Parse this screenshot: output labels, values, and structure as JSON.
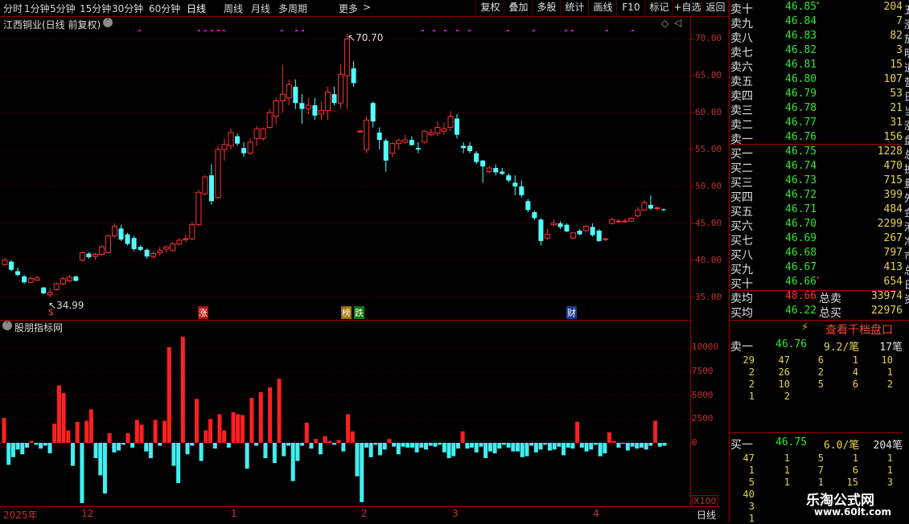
{
  "toolbar": {
    "periods": [
      "分时",
      "1分钟",
      "5分钟",
      "15分钟",
      "30分钟",
      "60分钟",
      "日线",
      "周线",
      "月线",
      "多周期",
      "更多"
    ],
    "active_period": "日线",
    "more_arrow": ">",
    "right_buttons": [
      "复权",
      "叠加",
      "多股",
      "统计",
      "画线",
      "F10",
      "标记",
      "+自选",
      "返回"
    ]
  },
  "chart": {
    "title": "江西铜业(日线 前复权)",
    "high_label": "70.70",
    "low_label": "34.99",
    "event_marks": [
      "$",
      "涨",
      "榜",
      "跌",
      "财"
    ],
    "colors": {
      "up": "#ff3232",
      "down": "#54ffff",
      "grid": "#800000",
      "axis_text": "#c03030",
      "magenta": "#ff00ff"
    }
  },
  "chart_data": [
    {
      "type": "candlestick",
      "title": "江西铜业(日线 前复权)",
      "ylim": [
        33,
        72
      ],
      "y_ticks": [
        35.0,
        40.0,
        45.0,
        50.0,
        55.0,
        60.0,
        65.0,
        70.0
      ],
      "ohlc": [
        [
          39.4,
          40.3,
          39.2,
          40.0
        ],
        [
          39.8,
          40.0,
          38.5,
          38.7
        ],
        [
          38.5,
          39.0,
          37.8,
          38.0
        ],
        [
          37.8,
          38.0,
          36.8,
          37.0
        ],
        [
          37.0,
          37.8,
          36.9,
          37.5
        ],
        [
          37.3,
          37.9,
          37.2,
          37.6
        ],
        [
          36.3,
          36.4,
          35.4,
          35.5
        ],
        [
          35.3,
          36.2,
          34.99,
          35.6
        ],
        [
          36.0,
          37.0,
          35.9,
          36.8
        ],
        [
          36.8,
          37.8,
          36.6,
          37.5
        ],
        [
          37.2,
          38.0,
          37.0,
          37.7
        ],
        [
          37.8,
          37.9,
          37.1,
          37.2
        ],
        [
          40.0,
          41.2,
          39.8,
          41.0
        ],
        [
          40.9,
          41.1,
          40.2,
          40.4
        ],
        [
          40.5,
          41.0,
          40.0,
          40.8
        ],
        [
          40.8,
          42.0,
          40.6,
          41.8
        ],
        [
          41.0,
          43.5,
          40.9,
          43.3
        ],
        [
          43.3,
          45.0,
          43.0,
          44.6
        ],
        [
          44.3,
          44.8,
          42.6,
          42.8
        ],
        [
          43.5,
          43.7,
          42.0,
          42.2
        ],
        [
          43.0,
          43.3,
          41.2,
          41.5
        ],
        [
          41.8,
          42.0,
          41.2,
          41.4
        ],
        [
          41.4,
          41.6,
          40.2,
          40.5
        ],
        [
          40.5,
          41.2,
          40.2,
          40.9
        ],
        [
          41.0,
          41.8,
          40.6,
          41.3
        ],
        [
          41.5,
          42.0,
          41.0,
          41.8
        ],
        [
          41.3,
          42.4,
          41.2,
          42.2
        ],
        [
          42.2,
          43.0,
          42.0,
          42.7
        ],
        [
          42.8,
          43.5,
          42.4,
          42.9
        ],
        [
          42.9,
          45.2,
          42.7,
          44.8
        ],
        [
          44.8,
          49.5,
          44.6,
          49.2
        ],
        [
          49.0,
          51.5,
          48.8,
          51.3
        ],
        [
          51.5,
          53.0,
          47.5,
          48.0
        ],
        [
          48.5,
          55.5,
          48.3,
          55.0
        ],
        [
          55.0,
          56.5,
          53.5,
          55.7
        ],
        [
          55.5,
          57.8,
          55.0,
          57.3
        ],
        [
          56.8,
          57.2,
          55.5,
          55.8
        ],
        [
          55.2,
          56.0,
          54.0,
          54.5
        ],
        [
          54.5,
          56.5,
          54.3,
          56.0
        ],
        [
          56.5,
          58.2,
          55.5,
          57.8
        ],
        [
          56.5,
          58.0,
          56.2,
          57.8
        ],
        [
          58.0,
          60.5,
          57.8,
          60.0
        ],
        [
          59.5,
          62.0,
          58.5,
          61.6
        ],
        [
          61.6,
          66.5,
          60.0,
          62.5
        ],
        [
          62.0,
          64.5,
          61.0,
          63.8
        ],
        [
          63.5,
          64.5,
          60.5,
          61.3
        ],
        [
          61.3,
          62.5,
          58.5,
          60.5
        ],
        [
          60.5,
          62.0,
          59.8,
          61.0
        ],
        [
          61.0,
          62.0,
          59.0,
          59.6
        ],
        [
          59.8,
          61.5,
          59.0,
          60.3
        ],
        [
          60.3,
          63.5,
          59.0,
          62.8
        ],
        [
          62.5,
          63.5,
          61.0,
          61.3
        ],
        [
          61.3,
          66.5,
          60.5,
          65.2
        ],
        [
          65.0,
          70.7,
          60.5,
          70.0
        ],
        [
          66.0,
          67.0,
          63.5,
          64.0
        ],
        [
          57.5,
          57.6,
          57.4,
          57.5
        ],
        [
          55.0,
          59.5,
          54.5,
          59.0
        ],
        [
          61.3,
          61.5,
          58.0,
          58.8
        ],
        [
          57.3,
          58.0,
          55.0,
          56.3
        ],
        [
          56.2,
          56.5,
          52.0,
          53.5
        ],
        [
          54.5,
          56.0,
          54.0,
          55.8
        ],
        [
          55.8,
          56.5,
          55.0,
          56.2
        ],
        [
          56.0,
          57.0,
          55.8,
          56.3
        ],
        [
          56.3,
          56.8,
          55.5,
          55.6
        ],
        [
          55.2,
          56.0,
          54.5,
          55.0
        ],
        [
          56.0,
          57.6,
          55.8,
          57.5
        ],
        [
          57.0,
          57.8,
          56.8,
          57.3
        ],
        [
          57.2,
          58.8,
          56.8,
          58.0
        ],
        [
          57.5,
          58.7,
          57.0,
          57.8
        ],
        [
          58.0,
          60.2,
          57.5,
          59.5
        ],
        [
          59.2,
          59.8,
          56.5,
          57.0
        ],
        [
          55.5,
          56.0,
          54.5,
          55.2
        ],
        [
          55.5,
          56.0,
          54.5,
          54.8
        ],
        [
          54.5,
          54.8,
          53.0,
          53.3
        ],
        [
          53.5,
          53.6,
          50.5,
          52.7
        ],
        [
          52.0,
          52.8,
          51.8,
          52.5
        ],
        [
          52.5,
          53.0,
          51.5,
          51.9
        ],
        [
          52.0,
          52.5,
          51.5,
          51.7
        ],
        [
          51.5,
          51.8,
          50.5,
          50.8
        ],
        [
          50.5,
          51.5,
          48.8,
          50.0
        ],
        [
          50.0,
          50.8,
          48.5,
          48.8
        ],
        [
          48.0,
          48.3,
          46.5,
          46.8
        ],
        [
          46.5,
          46.7,
          45.5,
          45.7
        ],
        [
          45.5,
          45.7,
          42.0,
          42.6
        ],
        [
          43.0,
          44.2,
          42.8,
          43.5
        ],
        [
          44.8,
          45.5,
          44.6,
          45.0
        ],
        [
          45.0,
          45.3,
          44.2,
          44.5
        ],
        [
          44.8,
          45.0,
          43.8,
          43.9
        ],
        [
          43.0,
          43.8,
          42.8,
          43.7
        ],
        [
          44.0,
          44.2,
          43.4,
          43.5
        ],
        [
          44.0,
          44.8,
          43.8,
          44.6
        ],
        [
          44.5,
          45.0,
          43.2,
          43.4
        ],
        [
          44.0,
          44.2,
          42.5,
          42.6
        ],
        [
          42.8,
          43.0,
          42.6,
          42.9
        ],
        [
          45.0,
          45.8,
          44.8,
          45.5
        ],
        [
          45.2,
          45.6,
          45.0,
          45.3
        ],
        [
          45.3,
          45.6,
          45.1,
          45.3
        ],
        [
          45.3,
          45.8,
          45.2,
          45.7
        ],
        [
          46.0,
          47.2,
          45.8,
          46.8
        ],
        [
          46.8,
          48.2,
          46.8,
          47.8
        ],
        [
          47.5,
          48.8,
          46.8,
          47.0
        ],
        [
          47.0,
          47.3,
          46.7,
          47.1
        ],
        [
          46.9,
          47.0,
          46.6,
          46.8
        ]
      ]
    },
    {
      "type": "bar",
      "title": "股朋指标网",
      "ylim": [
        -6500,
        11500
      ],
      "y_ticks": [
        0,
        2500,
        5000,
        7500,
        10000
      ],
      "unit_label": "X100",
      "values": [
        2600,
        -2300,
        -1500,
        -700,
        -1200,
        -500,
        200,
        -200,
        -600,
        -300,
        -1100,
        2000,
        6000,
        5200,
        1300,
        -2400,
        2200,
        -6300,
        2300,
        3500,
        -1600,
        -3400,
        -5300,
        1000,
        -1000,
        -800,
        -200,
        1000,
        -500,
        2400,
        1900,
        -900,
        -1600,
        2400,
        -300,
        2300,
        10000,
        -2400,
        -4200,
        11100,
        -1200,
        -300,
        4600,
        -1900,
        1300,
        2500,
        -600,
        3000,
        1300,
        -500,
        3200,
        3000,
        2900,
        -2700,
        4700,
        -300,
        5300,
        -1600,
        5800,
        -2100,
        6700,
        -1400,
        -300,
        -4000,
        -1900,
        -300,
        2100,
        -600,
        400,
        -1200,
        700,
        200,
        -200,
        300,
        -900,
        3000,
        1200,
        -3500,
        -6200,
        -500,
        -1500,
        -200,
        -1300,
        -700,
        400,
        -400,
        -1200,
        -400,
        -500,
        -500,
        -1000,
        -500,
        -700,
        -300,
        -400,
        -200,
        -1000,
        -1600,
        -1400,
        -600,
        1200,
        -600,
        -500,
        -1000,
        -400,
        -1600,
        -900,
        -1100,
        -600,
        -200,
        -500,
        -900,
        -900,
        -1500,
        -1400,
        -300,
        -1000,
        -700,
        -200,
        -800,
        -700,
        -400,
        -1300,
        -500,
        -600,
        2200,
        -500,
        -900,
        -700,
        -200,
        -1400,
        -1100,
        1100,
        200,
        -500,
        -100,
        -800,
        -400,
        -600,
        -500,
        -700,
        -300,
        2300,
        -400,
        -300
      ]
    }
  ],
  "indicator": {
    "title": "股朋指标网",
    "unit": "X100",
    "ticks": [
      "10000",
      "7500",
      "5000",
      "2500",
      "0"
    ]
  },
  "dates": {
    "year": "2025年",
    "months": [
      "12",
      "1",
      "2",
      "3",
      "4"
    ],
    "period_tag": "日线"
  },
  "orderbook": {
    "sells": [
      {
        "label": "卖十",
        "price": "46.85",
        "vol": "204",
        "mark": "*"
      },
      {
        "label": "卖九",
        "price": "46.84",
        "vol": "7"
      },
      {
        "label": "卖八",
        "price": "46.83",
        "vol": "82"
      },
      {
        "label": "卖七",
        "price": "46.82",
        "vol": "3"
      },
      {
        "label": "卖六",
        "price": "46.81",
        "vol": "15"
      },
      {
        "label": "卖五",
        "price": "46.80",
        "vol": "107"
      },
      {
        "label": "卖四",
        "price": "46.79",
        "vol": "53"
      },
      {
        "label": "卖三",
        "price": "46.78",
        "vol": "21"
      },
      {
        "label": "卖二",
        "price": "46.77",
        "vol": "31"
      },
      {
        "label": "卖一",
        "price": "46.76",
        "vol": "156"
      }
    ],
    "buys": [
      {
        "label": "买一",
        "price": "46.75",
        "vol": "1228"
      },
      {
        "label": "买二",
        "price": "46.74",
        "vol": "470"
      },
      {
        "label": "买三",
        "price": "46.73",
        "vol": "715"
      },
      {
        "label": "买四",
        "price": "46.72",
        "vol": "399"
      },
      {
        "label": "买五",
        "price": "46.71",
        "vol": "484"
      },
      {
        "label": "买六",
        "price": "46.70",
        "vol": "2299"
      },
      {
        "label": "买七",
        "price": "46.69",
        "vol": "267"
      },
      {
        "label": "买八",
        "price": "46.68",
        "vol": "797"
      },
      {
        "label": "买九",
        "price": "46.67",
        "vol": "413"
      },
      {
        "label": "买十",
        "price": "46.66",
        "vol": "654",
        "mark": "*"
      }
    ],
    "avg_sell_label": "卖均",
    "avg_sell": "48.66",
    "total_sell_label": "总卖",
    "total_sell": "33974",
    "avg_buy_label": "买均",
    "avg_buy": "46.22",
    "total_buy_label": "总买",
    "total_buy": "22976",
    "depth_link": "查看千档盘口",
    "sell1": {
      "label": "卖一",
      "price": "46.76",
      "per": "9.2/笔",
      "count": "17笔",
      "grid": [
        [
          "29",
          "47",
          "6",
          "1",
          "10"
        ],
        [
          "2",
          "26",
          "2",
          "4",
          "1"
        ],
        [
          "2",
          "10",
          "5",
          "6",
          "2"
        ],
        [
          "1",
          "2",
          "",
          "",
          ""
        ]
      ]
    },
    "buy1": {
      "label": "买一",
      "price": "46.75",
      "per": "6.0/笔",
      "count": "204笔",
      "grid": [
        [
          "47",
          "1",
          "5",
          "1",
          "1"
        ],
        [
          "1",
          "1",
          "7",
          "6",
          "1"
        ],
        [
          "5",
          "1",
          "1",
          "15",
          "3"
        ],
        [
          "40",
          "",
          "",
          "",
          ""
        ],
        [
          "3",
          "",
          "",
          "",
          ""
        ],
        [
          "1",
          "",
          "",
          "",
          ""
        ]
      ]
    },
    "edge_chars": [
      "五",
      "涨",
      "放",
      "明",
      "道",
      "营",
      "日",
      "当",
      "涨",
      "盘",
      "总",
      "换",
      "量",
      "外",
      "金",
      "港",
      "净",
      "市",
      "总",
      "日",
      "资"
    ]
  },
  "watermark": {
    "line1": "乐淘公式网",
    "line2": "www.60lt.com"
  }
}
